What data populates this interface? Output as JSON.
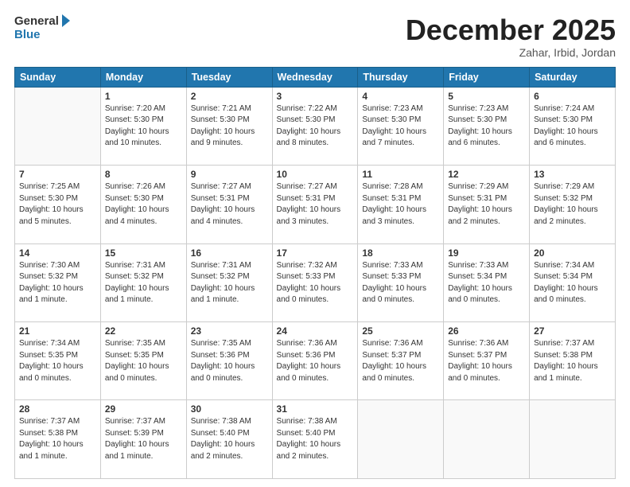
{
  "header": {
    "logo_general": "General",
    "logo_blue": "Blue",
    "month_title": "December 2025",
    "location": "Zahar, Irbid, Jordan"
  },
  "days_of_week": [
    "Sunday",
    "Monday",
    "Tuesday",
    "Wednesday",
    "Thursday",
    "Friday",
    "Saturday"
  ],
  "weeks": [
    [
      {
        "day": "",
        "info": ""
      },
      {
        "day": "1",
        "info": "Sunrise: 7:20 AM\nSunset: 5:30 PM\nDaylight: 10 hours\nand 10 minutes."
      },
      {
        "day": "2",
        "info": "Sunrise: 7:21 AM\nSunset: 5:30 PM\nDaylight: 10 hours\nand 9 minutes."
      },
      {
        "day": "3",
        "info": "Sunrise: 7:22 AM\nSunset: 5:30 PM\nDaylight: 10 hours\nand 8 minutes."
      },
      {
        "day": "4",
        "info": "Sunrise: 7:23 AM\nSunset: 5:30 PM\nDaylight: 10 hours\nand 7 minutes."
      },
      {
        "day": "5",
        "info": "Sunrise: 7:23 AM\nSunset: 5:30 PM\nDaylight: 10 hours\nand 6 minutes."
      },
      {
        "day": "6",
        "info": "Sunrise: 7:24 AM\nSunset: 5:30 PM\nDaylight: 10 hours\nand 6 minutes."
      }
    ],
    [
      {
        "day": "7",
        "info": "Sunrise: 7:25 AM\nSunset: 5:30 PM\nDaylight: 10 hours\nand 5 minutes."
      },
      {
        "day": "8",
        "info": "Sunrise: 7:26 AM\nSunset: 5:30 PM\nDaylight: 10 hours\nand 4 minutes."
      },
      {
        "day": "9",
        "info": "Sunrise: 7:27 AM\nSunset: 5:31 PM\nDaylight: 10 hours\nand 4 minutes."
      },
      {
        "day": "10",
        "info": "Sunrise: 7:27 AM\nSunset: 5:31 PM\nDaylight: 10 hours\nand 3 minutes."
      },
      {
        "day": "11",
        "info": "Sunrise: 7:28 AM\nSunset: 5:31 PM\nDaylight: 10 hours\nand 3 minutes."
      },
      {
        "day": "12",
        "info": "Sunrise: 7:29 AM\nSunset: 5:31 PM\nDaylight: 10 hours\nand 2 minutes."
      },
      {
        "day": "13",
        "info": "Sunrise: 7:29 AM\nSunset: 5:32 PM\nDaylight: 10 hours\nand 2 minutes."
      }
    ],
    [
      {
        "day": "14",
        "info": "Sunrise: 7:30 AM\nSunset: 5:32 PM\nDaylight: 10 hours\nand 1 minute."
      },
      {
        "day": "15",
        "info": "Sunrise: 7:31 AM\nSunset: 5:32 PM\nDaylight: 10 hours\nand 1 minute."
      },
      {
        "day": "16",
        "info": "Sunrise: 7:31 AM\nSunset: 5:32 PM\nDaylight: 10 hours\nand 1 minute."
      },
      {
        "day": "17",
        "info": "Sunrise: 7:32 AM\nSunset: 5:33 PM\nDaylight: 10 hours\nand 0 minutes."
      },
      {
        "day": "18",
        "info": "Sunrise: 7:33 AM\nSunset: 5:33 PM\nDaylight: 10 hours\nand 0 minutes."
      },
      {
        "day": "19",
        "info": "Sunrise: 7:33 AM\nSunset: 5:34 PM\nDaylight: 10 hours\nand 0 minutes."
      },
      {
        "day": "20",
        "info": "Sunrise: 7:34 AM\nSunset: 5:34 PM\nDaylight: 10 hours\nand 0 minutes."
      }
    ],
    [
      {
        "day": "21",
        "info": "Sunrise: 7:34 AM\nSunset: 5:35 PM\nDaylight: 10 hours\nand 0 minutes."
      },
      {
        "day": "22",
        "info": "Sunrise: 7:35 AM\nSunset: 5:35 PM\nDaylight: 10 hours\nand 0 minutes."
      },
      {
        "day": "23",
        "info": "Sunrise: 7:35 AM\nSunset: 5:36 PM\nDaylight: 10 hours\nand 0 minutes."
      },
      {
        "day": "24",
        "info": "Sunrise: 7:36 AM\nSunset: 5:36 PM\nDaylight: 10 hours\nand 0 minutes."
      },
      {
        "day": "25",
        "info": "Sunrise: 7:36 AM\nSunset: 5:37 PM\nDaylight: 10 hours\nand 0 minutes."
      },
      {
        "day": "26",
        "info": "Sunrise: 7:36 AM\nSunset: 5:37 PM\nDaylight: 10 hours\nand 0 minutes."
      },
      {
        "day": "27",
        "info": "Sunrise: 7:37 AM\nSunset: 5:38 PM\nDaylight: 10 hours\nand 1 minute."
      }
    ],
    [
      {
        "day": "28",
        "info": "Sunrise: 7:37 AM\nSunset: 5:38 PM\nDaylight: 10 hours\nand 1 minute."
      },
      {
        "day": "29",
        "info": "Sunrise: 7:37 AM\nSunset: 5:39 PM\nDaylight: 10 hours\nand 1 minute."
      },
      {
        "day": "30",
        "info": "Sunrise: 7:38 AM\nSunset: 5:40 PM\nDaylight: 10 hours\nand 2 minutes."
      },
      {
        "day": "31",
        "info": "Sunrise: 7:38 AM\nSunset: 5:40 PM\nDaylight: 10 hours\nand 2 minutes."
      },
      {
        "day": "",
        "info": ""
      },
      {
        "day": "",
        "info": ""
      },
      {
        "day": "",
        "info": ""
      }
    ]
  ]
}
